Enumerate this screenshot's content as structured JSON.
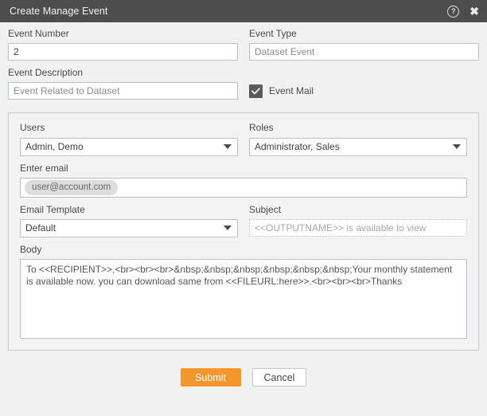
{
  "titlebar": {
    "title": "Create Manage Event",
    "help_icon": "help-circle-icon",
    "help_glyph": "?",
    "close_icon": "close-icon",
    "close_glyph": "✖"
  },
  "form": {
    "event_number": {
      "label": "Event Number",
      "value": "2"
    },
    "event_type": {
      "label": "Event Type",
      "value": "Dataset Event"
    },
    "event_description": {
      "label": "Event Description",
      "value": "Event Related to Dataset"
    },
    "event_mail": {
      "label": "Event Mail",
      "checked": "true"
    },
    "users": {
      "label": "Users",
      "value": "Admin, Demo"
    },
    "roles": {
      "label": "Roles",
      "value": "Administrator, Sales"
    },
    "email": {
      "label": "Enter email",
      "chip": "user@account.com"
    },
    "email_template": {
      "label": "Email Template",
      "value": "Default"
    },
    "subject": {
      "label": "Subject",
      "value": "<<OUTPUTNAME>> is available to view"
    },
    "body": {
      "label": "Body",
      "value": "To <<RECIPIENT>>,<br><br><br>&nbsp;&nbsp;&nbsp;&nbsp;&nbsp;&nbsp;Your monthly statement is available now. you can download same from <<FILEURL:here>>.<br><br><br>Thanks"
    }
  },
  "footer": {
    "submit_label": "Submit",
    "cancel_label": "Cancel"
  },
  "colors": {
    "titlebar": "#4d4d4d",
    "accent_orange": "#f4962c",
    "background": "#f1f1f1",
    "input_border": "#b7c0cc",
    "checkbox_fill": "#5a5a5a"
  }
}
